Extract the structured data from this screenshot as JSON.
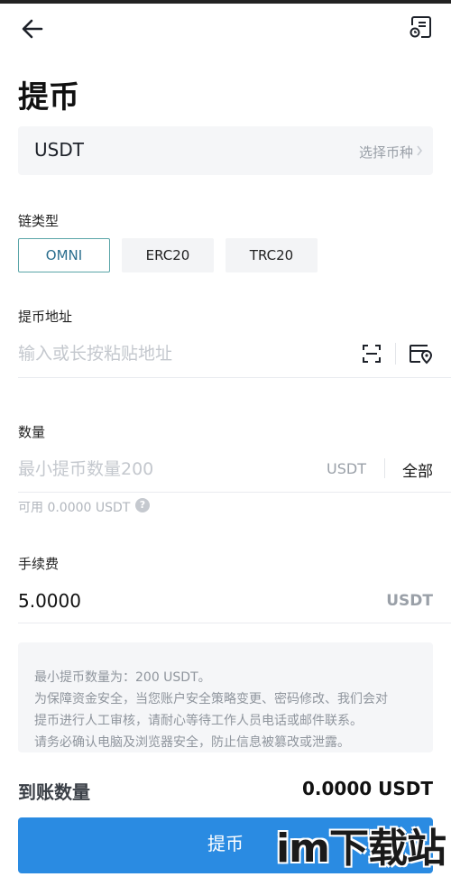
{
  "header": {
    "title": "提币",
    "back_icon": "back-arrow-icon",
    "record_icon": "withdraw-record-icon"
  },
  "coin": {
    "symbol": "USDT",
    "choose_label": "选择币种"
  },
  "chain": {
    "label": "链类型",
    "options": [
      "OMNI",
      "ERC20",
      "TRC20"
    ],
    "selected": "OMNI"
  },
  "address": {
    "label": "提币地址",
    "placeholder": "输入或长按粘贴地址",
    "value": ""
  },
  "amount": {
    "label": "数量",
    "placeholder": "最小提币数量200",
    "unit": "USDT",
    "all_label": "全部",
    "available": "可用 0.0000 USDT"
  },
  "fee": {
    "label": "手续费",
    "value": "5.0000",
    "unit": "USDT"
  },
  "notice": {
    "lines": [
      "最小提币数量为：200 USDT。",
      "为保障资金安全，当您账户安全策略变更、密码修改、我们会对",
      "提币进行人工审核，请耐心等待工作人员电话或邮件联系。",
      "请务必确认电脑及浏览器安全，防止信息被篡改或泄露。"
    ]
  },
  "receive": {
    "label": "到账数量",
    "value": "0.0000 USDT"
  },
  "submit": {
    "label": "提币"
  },
  "watermark": {
    "text": "im下载站"
  },
  "colors": {
    "primary": "#2a8be2",
    "selected_border": "#5aa5a8",
    "muted": "#9aa0a8"
  }
}
